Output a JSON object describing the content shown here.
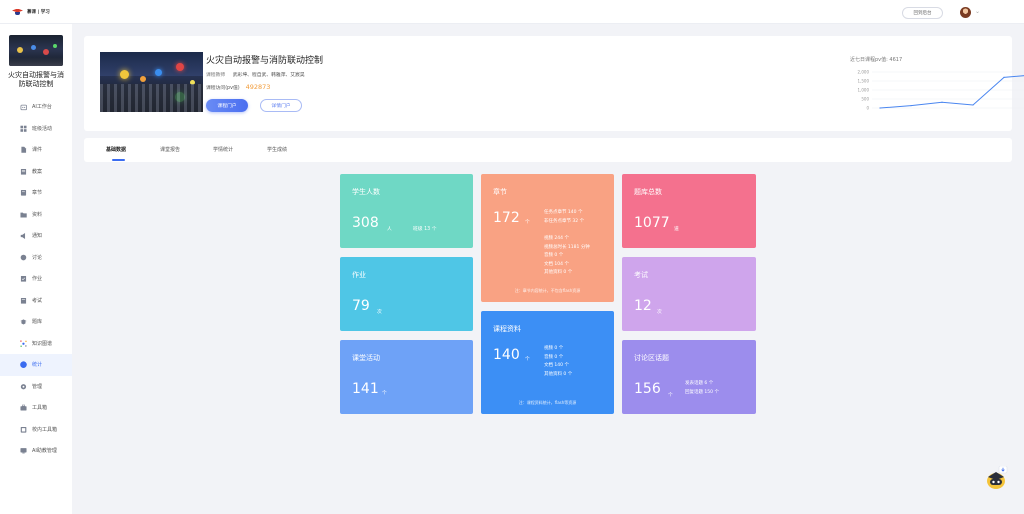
{
  "topbar": {
    "logo_text": "慕课 | 学习",
    "back_label": "回到后台"
  },
  "sidebar": {
    "course_title": "火灾自动报警与消防联动控制",
    "items": [
      {
        "label": "AI工作台",
        "icon": "robot-icon"
      },
      {
        "label": "班级活动",
        "icon": "grid-icon"
      },
      {
        "label": "课件",
        "icon": "file-icon"
      },
      {
        "label": "教案",
        "icon": "lesson-icon"
      },
      {
        "label": "章节",
        "icon": "chapter-icon"
      },
      {
        "label": "资料",
        "icon": "folder-icon"
      },
      {
        "label": "通知",
        "icon": "megaphone-icon"
      },
      {
        "label": "讨论",
        "icon": "chat-icon"
      },
      {
        "label": "作业",
        "icon": "homework-icon"
      },
      {
        "label": "考试",
        "icon": "exam-icon"
      },
      {
        "label": "题库",
        "icon": "database-icon"
      },
      {
        "label": "知识图谱",
        "icon": "graph-icon"
      },
      {
        "label": "统计",
        "icon": "pie-icon"
      },
      {
        "label": "管理",
        "icon": "gear-icon"
      },
      {
        "label": "工具箱",
        "icon": "toolbox-icon"
      },
      {
        "label": "校内工具箱",
        "icon": "school-tools-icon"
      },
      {
        "label": "AI助教管理",
        "icon": "ai-assistant-icon"
      }
    ],
    "active_index": 12
  },
  "course": {
    "title": "火灾自动报警与消防联动控制",
    "teachers_label": "课程教师",
    "teachers": "武彩坤、程自武、韩雅萍、艾宸昊",
    "pv_label": "课程访问(pv值)",
    "pv_value": "492873",
    "btn_portal": "课程门户",
    "btn_detail": "详情门户"
  },
  "chart_data": {
    "type": "line",
    "title": "近七日课程pv值: 4617",
    "y_ticks": [
      "2,000",
      "1,500",
      "1,000",
      "500",
      "0"
    ],
    "ylim": [
      0,
      2000
    ],
    "values": [
      0,
      130,
      320,
      170,
      1700,
      1850,
      400
    ],
    "color": "#4a86f0"
  },
  "tabs": [
    {
      "label": "基础数据",
      "active": true
    },
    {
      "label": "课堂报告",
      "active": false
    },
    {
      "label": "学情统计",
      "active": false
    },
    {
      "label": "学生成绩",
      "active": false
    }
  ],
  "cards": {
    "students": {
      "title": "学生人数",
      "value": "308",
      "unit": "人",
      "extra": "班级 13 个",
      "color": "#6fd8c5"
    },
    "chapters": {
      "title": "章节",
      "value": "172",
      "unit": "个",
      "lines": [
        "任务点章节 140 个",
        "非任务点章节 32 个"
      ],
      "lines2": [
        "视频 244 个",
        "视频总时长 1181 分钟",
        "音频 0 个",
        "文档 104 个",
        "其他资料 0 个"
      ],
      "foot": "注：章节内容统计，不包含flash资源",
      "color": "#f9a283"
    },
    "questions": {
      "title": "题库总数",
      "value": "1077",
      "unit": "道",
      "color": "#f4718e"
    },
    "homework": {
      "title": "作业",
      "value": "79",
      "unit": "次",
      "color": "#4fc6e6"
    },
    "exam": {
      "title": "考试",
      "value": "12",
      "unit": "次",
      "color": "#cfa5ec"
    },
    "materials": {
      "title": "课程资料",
      "value": "140",
      "unit": "个",
      "lines": [
        "视频 0 个",
        "音频 0 个",
        "文档 140 个",
        "其他资料 0 个"
      ],
      "foot": "注：课程资料统计，flash等资源",
      "color": "#3c8ff5"
    },
    "activities": {
      "title": "课堂活动",
      "value": "141",
      "unit": "个",
      "color": "#6ea2f7"
    },
    "discussion": {
      "title": "讨论区话题",
      "value": "156",
      "unit": "个",
      "lines": [
        "发表话题 6 个",
        "回复话题 150 个"
      ],
      "color": "#9c8ded"
    }
  }
}
